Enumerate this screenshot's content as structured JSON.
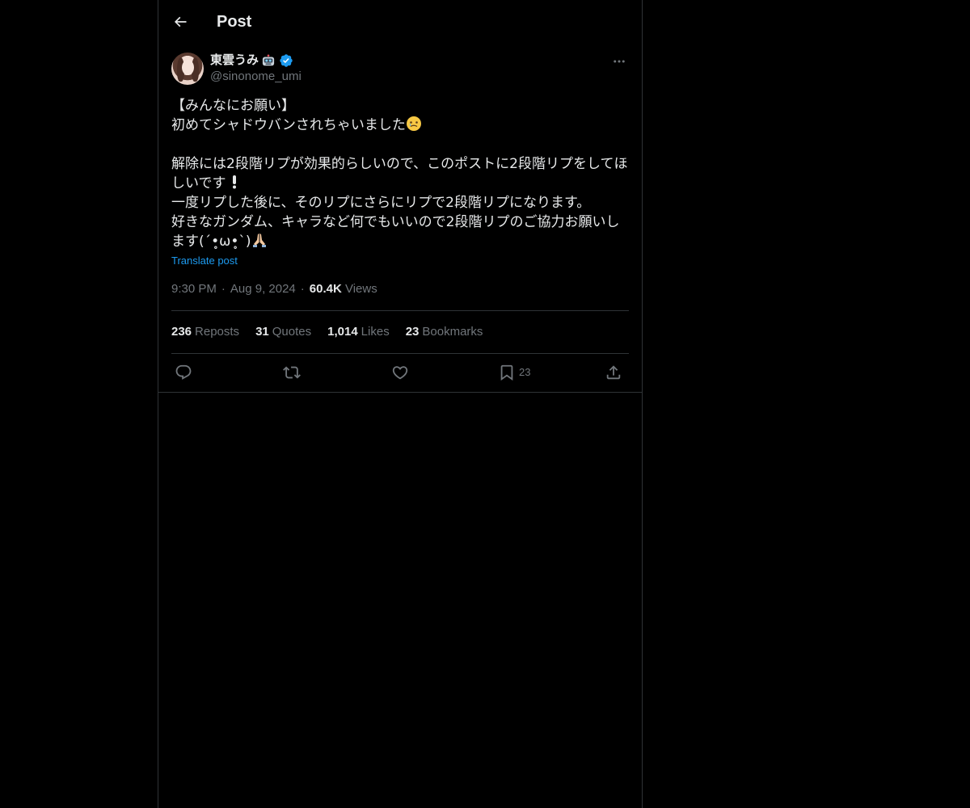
{
  "header": {
    "title": "Post",
    "back_icon": "arrow-left-icon"
  },
  "author": {
    "display_name": "東雲うみ",
    "name_emoji": "robot-face-emoji",
    "verified_icon": "verified-badge-icon",
    "handle": "@sinonome_umi",
    "more_icon": "more-horizontal-icon"
  },
  "post": {
    "lines": [
      "【みんなにお願い】",
      "初めてシャドウバンされちゃいました",
      "",
      "解除には2段階リプが効果的らしいので、このポストに2段階リプをしてほ",
      "しいです",
      "一度リプした後に、そのリプにさらにリプで2段階リプになります。",
      "好きなガンダム、キャラなど何でもいいので2段階リプのご協力お願いし",
      "ます(´•̥ω•̥`)"
    ],
    "translate_label": "Translate post"
  },
  "meta": {
    "time": "9:30 PM",
    "date": "Aug 9, 2024",
    "separator": "·",
    "views_count": "60.4K",
    "views_label": "Views"
  },
  "stats": {
    "reposts_count": "236",
    "reposts_label": "Reposts",
    "quotes_count": "31",
    "quotes_label": "Quotes",
    "likes_count": "1,014",
    "likes_label": "Likes",
    "bookmarks_count": "23",
    "bookmarks_label": "Bookmarks"
  },
  "actions": {
    "reply_icon": "reply-icon",
    "repost_icon": "repost-icon",
    "like_icon": "heart-icon",
    "bookmark_icon": "bookmark-icon",
    "bookmark_count": "23",
    "share_icon": "share-icon"
  },
  "colors": {
    "background": "#000000",
    "text_primary": "#e7e9ea",
    "text_secondary": "#71767b",
    "accent": "#1d9bf0",
    "border": "#2f3336"
  }
}
